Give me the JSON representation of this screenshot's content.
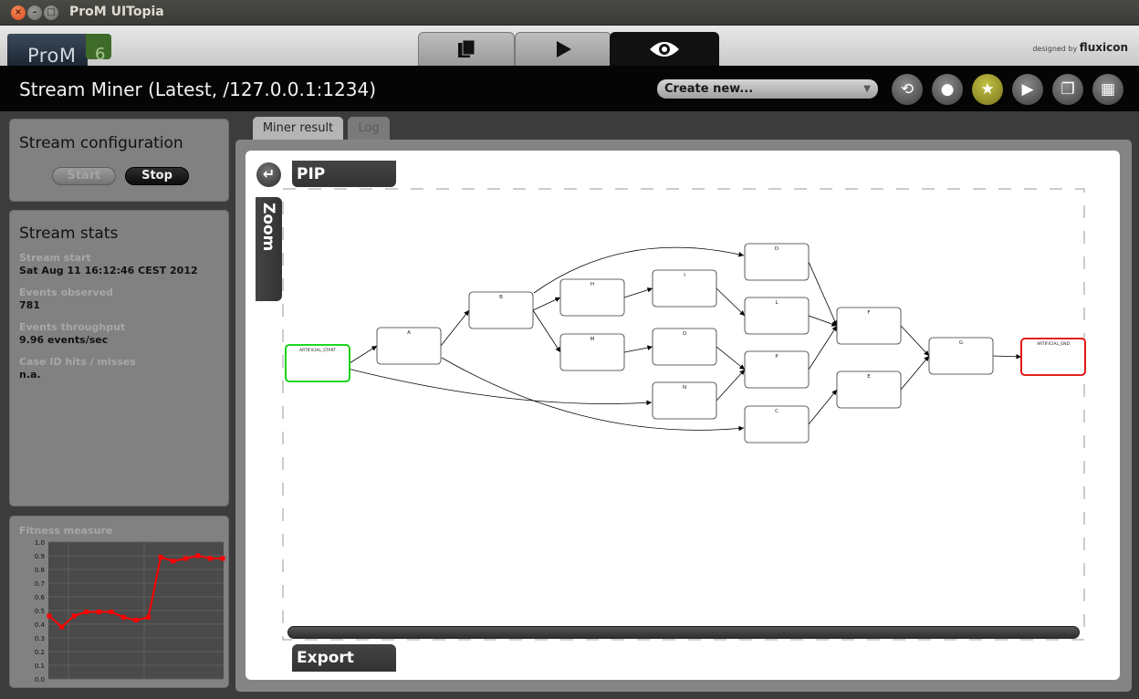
{
  "window": {
    "title": "ProM UITopia",
    "close_glyph": "×",
    "minimize_glyph": "–",
    "maximize_glyph": "□"
  },
  "header": {
    "logo_text": "ProM",
    "logo_version": "6",
    "designed_by": "designed by",
    "brand": "fluxicon",
    "top_tabs": [
      {
        "icon": "workspace-icon",
        "active": false
      },
      {
        "icon": "play-icon",
        "active": false
      },
      {
        "icon": "eye-icon",
        "active": true
      }
    ]
  },
  "toolbar": {
    "title": "Stream Miner (Latest, /127.0.0.1:1234)",
    "create_new": "Create new...",
    "buttons": [
      "refresh-icon",
      "drop-icon",
      "star-icon",
      "play-icon",
      "copy-icon",
      "grid-icon"
    ]
  },
  "stream_config": {
    "title": "Stream configuration",
    "start": "Start",
    "stop": "Stop"
  },
  "stream_stats": {
    "title": "Stream stats",
    "items": [
      {
        "label": "Stream start",
        "value": "Sat Aug 11 16:12:46 CEST 2012"
      },
      {
        "label": "Events observed",
        "value": "781"
      },
      {
        "label": "Events throughput",
        "value": "9.96 events/sec"
      },
      {
        "label": "Case ID hits / misses",
        "value": "n.a."
      }
    ]
  },
  "fitness": {
    "title": "Fitness measure",
    "chart_data": {
      "type": "line",
      "title": "Fitness measure",
      "ylim": [
        0,
        1
      ],
      "yticks": [
        "0.0",
        "0.1",
        "0.2",
        "0.3",
        "0.4",
        "0.5",
        "0.6",
        "0.7",
        "0.8",
        "0.9",
        "1.0"
      ],
      "grid": true,
      "series": [
        {
          "color": "#ff0000",
          "values": [
            0.46,
            0.38,
            0.46,
            0.49,
            0.49,
            0.49,
            0.45,
            0.43,
            0.45,
            0.89,
            0.86,
            0.88,
            0.9,
            0.88,
            0.88
          ]
        }
      ]
    }
  },
  "center": {
    "tabs": [
      "Miner result",
      "Log"
    ],
    "pip": "PIP",
    "zoom": "Zoom",
    "export": "Export",
    "back_glyph": "↵"
  },
  "graph": {
    "nodes": [
      {
        "id": "START",
        "label": "ARTIFICIAL_START",
        "color": "#00d000"
      },
      {
        "id": "A",
        "label": "A"
      },
      {
        "id": "B",
        "label": "B"
      },
      {
        "id": "H",
        "label": "H"
      },
      {
        "id": "M",
        "label": "M"
      },
      {
        "id": "I",
        "label": "I"
      },
      {
        "id": "O",
        "label": "O"
      },
      {
        "id": "N",
        "label": "N"
      },
      {
        "id": "D",
        "label": "D"
      },
      {
        "id": "L",
        "label": "L"
      },
      {
        "id": "P",
        "label": "P"
      },
      {
        "id": "C",
        "label": "C"
      },
      {
        "id": "F",
        "label": "F"
      },
      {
        "id": "E",
        "label": "E"
      },
      {
        "id": "G",
        "label": "G"
      },
      {
        "id": "END",
        "label": "ARTIFICIAL_END",
        "color": "#e00000"
      }
    ],
    "edges": [
      [
        "START",
        "A"
      ],
      [
        "START",
        "N"
      ],
      [
        "A",
        "B"
      ],
      [
        "A",
        "C"
      ],
      [
        "B",
        "H"
      ],
      [
        "B",
        "M"
      ],
      [
        "B",
        "D"
      ],
      [
        "H",
        "I"
      ],
      [
        "M",
        "O"
      ],
      [
        "I",
        "L"
      ],
      [
        "O",
        "P"
      ],
      [
        "N",
        "P"
      ],
      [
        "D",
        "F"
      ],
      [
        "L",
        "F"
      ],
      [
        "P",
        "F"
      ],
      [
        "C",
        "E"
      ],
      [
        "F",
        "G"
      ],
      [
        "E",
        "G"
      ],
      [
        "G",
        "END"
      ]
    ]
  }
}
